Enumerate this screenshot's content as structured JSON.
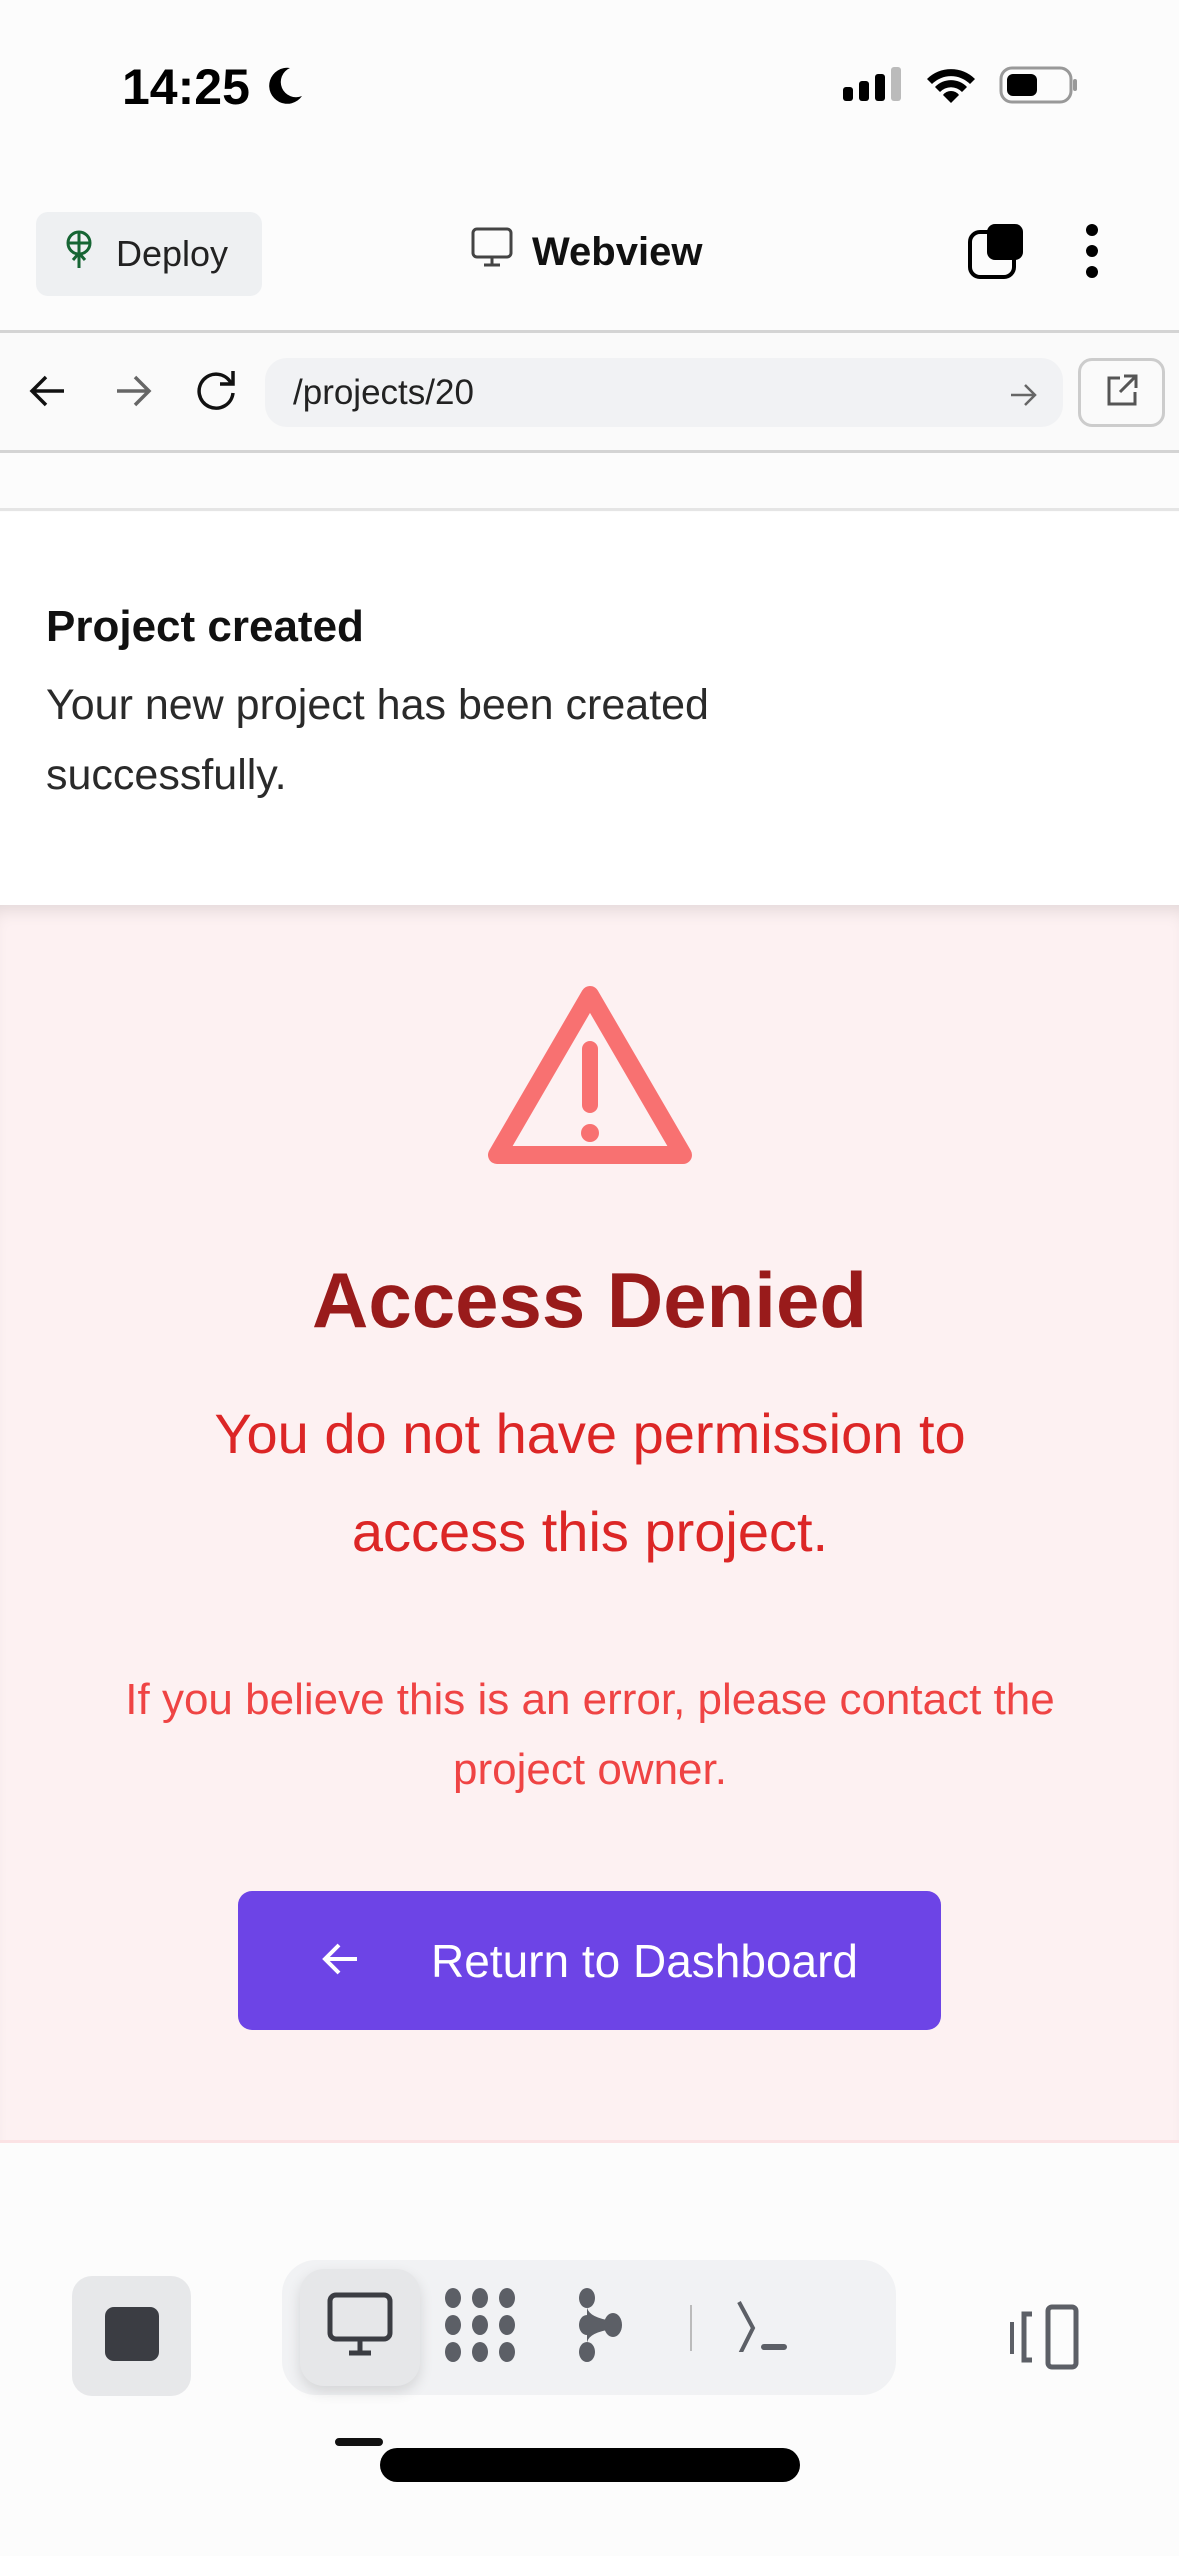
{
  "status_bar": {
    "time": "14:25"
  },
  "header": {
    "deploy_label": "Deploy",
    "title": "Webview"
  },
  "browser": {
    "url": "/projects/20"
  },
  "toast": {
    "title": "Project created",
    "message": "Your new project has been created successfully."
  },
  "error": {
    "title": "Access Denied",
    "message": "You do not have permission to access this project.",
    "hint": "If you believe this is an error, please contact the project owner.",
    "button_label": "Return to Dashboard"
  },
  "colors": {
    "accent": "#6d44e6",
    "error_title": "#991b1b",
    "error_text": "#dc2626",
    "error_bg": "#fdf1f2",
    "icon": "#f87171"
  }
}
